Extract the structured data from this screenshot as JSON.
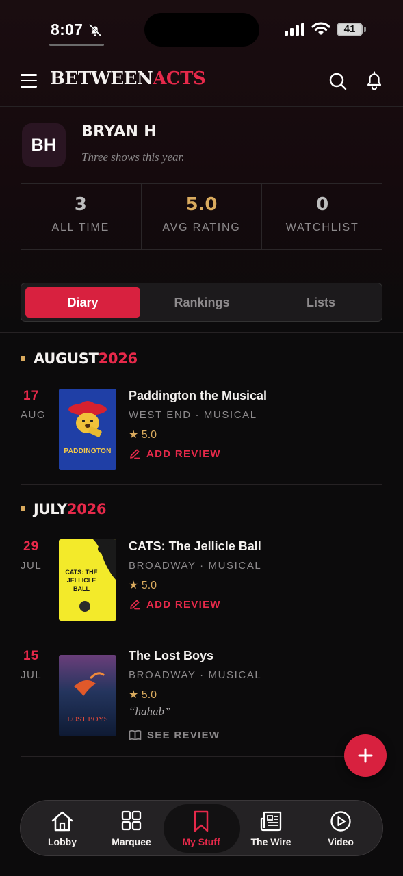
{
  "status_bar": {
    "time": "8:07",
    "battery": "41"
  },
  "header": {
    "brand_part1": "BETWEEN",
    "brand_part2": "ACTS"
  },
  "profile": {
    "initials": "BH",
    "name": "BRYAN H",
    "tagline": "Three shows this year.",
    "stats": [
      {
        "value": "3",
        "label": "ALL TIME"
      },
      {
        "value": "5.0",
        "label": "AVG RATING"
      },
      {
        "value": "0",
        "label": "WATCHLIST"
      }
    ]
  },
  "tabs": [
    {
      "label": "Diary",
      "active": true
    },
    {
      "label": "Rankings",
      "active": false
    },
    {
      "label": "Lists",
      "active": false
    }
  ],
  "diary": [
    {
      "month": "AUGUST",
      "year": "2026",
      "entries": [
        {
          "day": "17",
          "mon": "AUG",
          "title": "Paddington the Musical",
          "meta": "WEST END · MUSICAL",
          "rating": "★ 5.0",
          "action": "ADD REVIEW",
          "poster_text": "PADDINGTON"
        }
      ]
    },
    {
      "month": "JULY",
      "year": "2026",
      "entries": [
        {
          "day": "29",
          "mon": "JUL",
          "title": "CATS: The Jellicle Ball",
          "meta": "BROADWAY · MUSICAL",
          "rating": "★ 5.0",
          "action": "ADD REVIEW",
          "poster_text": "CATS: THE JELLICLE BALL"
        },
        {
          "day": "15",
          "mon": "JUL",
          "title": "The Lost Boys",
          "meta": "BROADWAY · MUSICAL",
          "rating": "★ 5.0",
          "quote": "“hahab”",
          "action": "SEE REVIEW",
          "poster_text": "LOST BOYS"
        }
      ]
    }
  ],
  "bottom_nav": [
    {
      "label": "Lobby",
      "icon": "home-icon"
    },
    {
      "label": "Marquee",
      "icon": "grid-icon"
    },
    {
      "label": "My Stuff",
      "icon": "bookmark-icon",
      "active": true
    },
    {
      "label": "The Wire",
      "icon": "newspaper-icon"
    },
    {
      "label": "Video",
      "icon": "play-icon"
    }
  ],
  "colors": {
    "accent": "#e6294a",
    "gold": "#d9aa5e",
    "background": "#0c0b0c"
  }
}
